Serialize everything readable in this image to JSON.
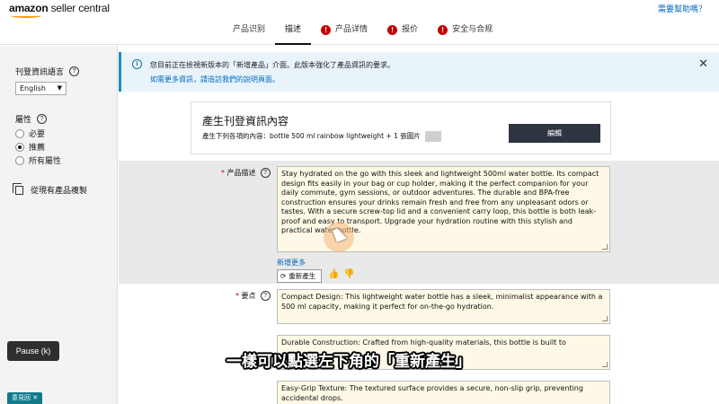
{
  "header": {
    "logo_brand": "amazon",
    "logo_product": "seller central",
    "help_link": "需要幫助嗎？",
    "tabs": [
      {
        "label": "产品识别",
        "alert": false,
        "active": false
      },
      {
        "label": "描述",
        "alert": false,
        "active": true
      },
      {
        "label": "产品详情",
        "alert": true,
        "active": false
      },
      {
        "label": "报价",
        "alert": true,
        "active": false
      },
      {
        "label": "安全与合规",
        "alert": true,
        "active": false
      }
    ]
  },
  "sidebar": {
    "language_label": "刊登資訊語言",
    "language_value": "English",
    "attributes_label": "屬性",
    "options": [
      {
        "label": "必要",
        "checked": false
      },
      {
        "label": "推薦",
        "checked": true
      },
      {
        "label": "所有屬性",
        "checked": false
      }
    ],
    "copy_label": "從現有產品複製"
  },
  "banner": {
    "text": "您目前正在檢視新版本的「新增產品」介面。此版本強化了產品資訊的要求。",
    "link": "如需更多資訊，請造訪我們的說明頁面。"
  },
  "generate_card": {
    "title": "產生刊登資訊內容",
    "subtitle": "產生下列各項的內容：bottle 500 ml rainbow lightweight + 1 張圖片",
    "edit_button": "編輯"
  },
  "description": {
    "label": "产品描述",
    "text": "Stay hydrated on the go with this sleek and lightweight 500ml water bottle. Its compact design fits easily in your bag or cup holder, making it the perfect companion for your daily commute, gym sessions, or outdoor adventures. The durable and BPA-free construction ensures your drinks remain fresh and free from any unpleasant odors or tastes. With a secure screw-top lid and a convenient carry loop, this bottle is both leak-proof and easy to transport. Upgrade your hydration routine with this stylish and practical water bottle.",
    "more_link": "新增更多",
    "regenerate_button": "重新產生"
  },
  "bullets": {
    "label": "要点",
    "items": [
      "Compact Design: This lightweight water bottle has a sleek, minimalist appearance with a 500 ml capacity, making it perfect for on-the-go hydration.",
      "Durable Construction: Crafted from high-quality materials, this bottle is built to",
      "Easy-Grip Texture: The textured surface provides a secure, non-slip grip, preventing accidental drops."
    ]
  },
  "overlay": {
    "pause_label": "Pause (k)",
    "feedback_label": "意見回",
    "subtitle": "一樣可以點選左下角的「重新產生」"
  },
  "colors": {
    "accent_blue": "#0066c0",
    "alert_red": "#c40000",
    "edit_button_bg": "#2e3540",
    "textbox_bg": "#fdf9e6"
  }
}
